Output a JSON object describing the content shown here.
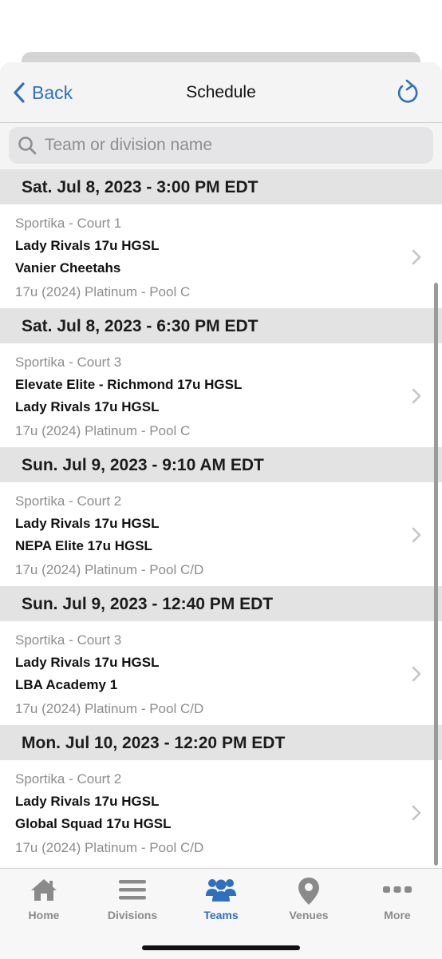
{
  "navbar": {
    "back_label": "Back",
    "title": "Schedule"
  },
  "search": {
    "placeholder": "Team or division name"
  },
  "sections": [
    {
      "header": "Sat. Jul 8, 2023 - 3:00 PM EDT",
      "game": {
        "venue": "Sportika - Court 1",
        "team1": "Lady Rivals 17u HGSL",
        "team2": "Vanier Cheetahs",
        "division": "17u (2024) Platinum - Pool C"
      }
    },
    {
      "header": "Sat. Jul 8, 2023 - 6:30 PM EDT",
      "game": {
        "venue": "Sportika - Court 3",
        "team1": "Elevate Elite - Richmond 17u HGSL",
        "team2": "Lady Rivals 17u HGSL",
        "division": "17u (2024) Platinum - Pool C"
      }
    },
    {
      "header": "Sun. Jul 9, 2023 - 9:10 AM EDT",
      "game": {
        "venue": "Sportika - Court 2",
        "team1": "Lady Rivals 17u HGSL",
        "team2": "NEPA Elite 17u HGSL",
        "division": "17u (2024) Platinum - Pool C/D"
      }
    },
    {
      "header": "Sun. Jul 9, 2023 - 12:40 PM EDT",
      "game": {
        "venue": "Sportika - Court 3",
        "team1": "Lady Rivals 17u HGSL",
        "team2": "LBA Academy 1",
        "division": "17u (2024) Platinum - Pool C/D"
      }
    },
    {
      "header": "Mon. Jul 10, 2023 - 12:20 PM EDT",
      "game": {
        "venue": "Sportika - Court 2",
        "team1": "Lady Rivals 17u HGSL",
        "team2": "Global Squad 17u HGSL",
        "division": "17u (2024) Platinum - Pool C/D"
      }
    }
  ],
  "tabbar": {
    "tabs": [
      {
        "label": "Home",
        "icon": "home-icon"
      },
      {
        "label": "Divisions",
        "icon": "list-icon"
      },
      {
        "label": "Teams",
        "icon": "people-icon"
      },
      {
        "label": "Venues",
        "icon": "location-pin-icon"
      },
      {
        "label": "More",
        "icon": "ellipsis-icon"
      }
    ],
    "active": "Teams"
  },
  "colors": {
    "accent": "#2f6fc0",
    "section_header_bg": "#e3e3e3",
    "secondary_text": "#8d8d8d",
    "inactive_tab": "#8a8a8a"
  }
}
